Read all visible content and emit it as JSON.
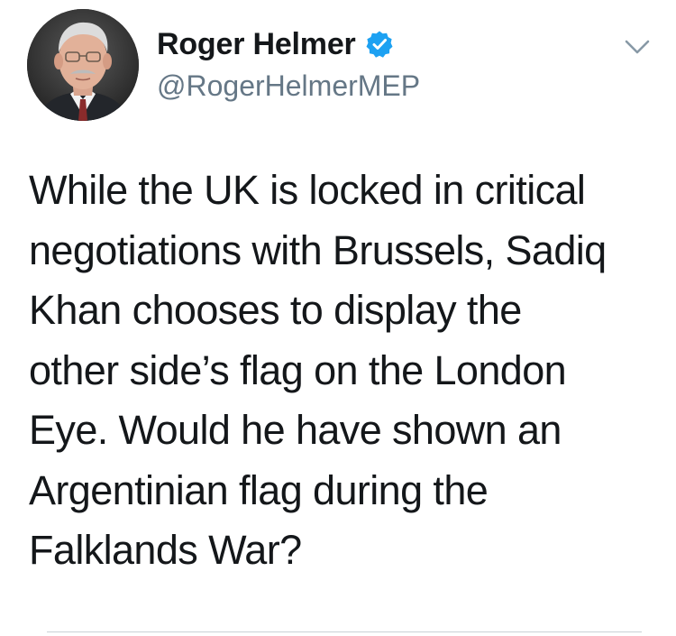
{
  "author": {
    "display_name": "Roger Helmer",
    "handle": "@RogerHelmerMEP",
    "verified": true,
    "avatar_icon": "profile-photo"
  },
  "tweet": {
    "text": "While the UK is locked in critical\nnegotiations with Brussels, Sadiq\nKhan chooses to display the\nother side’s flag on the London\nEye. Would he have shown an\nArgentinian flag during the\nFalklands War?"
  },
  "icons": {
    "verified": "verified-badge-icon",
    "menu": "chevron-down-icon"
  },
  "colors": {
    "text_primary": "#14171a",
    "text_secondary": "#657786",
    "verified_blue": "#1da1f2",
    "divider": "#c9d0d6",
    "chevron": "#8899a6"
  }
}
